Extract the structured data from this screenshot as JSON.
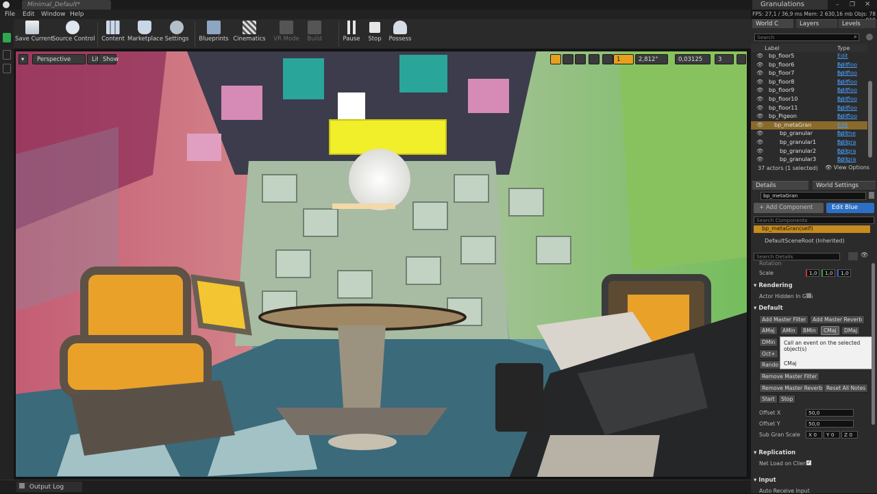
{
  "title_bar": {
    "tab": "Minimal_Default*",
    "project": "Granulations"
  },
  "menu": [
    "File",
    "Edit",
    "Window",
    "Help"
  ],
  "stats": "FPS: 27,1 / 36,9 ms Mem: 2 630,16 mb Objs: 78 919",
  "toolbar": [
    {
      "label": "Save Current",
      "enabled": true
    },
    {
      "label": "Source Control",
      "enabled": true
    },
    {
      "label": "Content",
      "enabled": true
    },
    {
      "label": "Marketplace",
      "enabled": true
    },
    {
      "label": "Settings",
      "enabled": true
    },
    {
      "label": "Blueprints",
      "enabled": true
    },
    {
      "label": "Cinematics",
      "enabled": true
    },
    {
      "label": "VR Mode",
      "enabled": false
    },
    {
      "label": "Build",
      "enabled": false
    },
    {
      "label": "Pause",
      "enabled": true
    },
    {
      "label": "Stop",
      "enabled": true
    },
    {
      "label": "Possess",
      "enabled": true
    }
  ],
  "viewport": {
    "perspective": "Perspective",
    "lit": "Lit",
    "show": "Show",
    "rotation_snap": "2,812°",
    "scale_snap": "0,03125",
    "camera_speed": "3",
    "grid_snap": "1"
  },
  "status_bar": {
    "output_log": "Output Log"
  },
  "outliner": {
    "tabs": [
      "World C",
      "Layers",
      "Levels"
    ],
    "search_placeholder": "Search",
    "col_label": "Label",
    "col_type": "Type",
    "items": [
      {
        "name": "bp_floor5",
        "type": "Edit bp_floo",
        "indent": 1,
        "selected": false
      },
      {
        "name": "bp_floor6",
        "type": "Edit bp_floo",
        "indent": 1,
        "selected": false
      },
      {
        "name": "bp_floor7",
        "type": "Edit bp_floo",
        "indent": 1,
        "selected": false
      },
      {
        "name": "bp_floor8",
        "type": "Edit bp_floo",
        "indent": 1,
        "selected": false
      },
      {
        "name": "bp_floor9",
        "type": "Edit bp_floo",
        "indent": 1,
        "selected": false
      },
      {
        "name": "bp_floor10",
        "type": "Edit bp_floo",
        "indent": 1,
        "selected": false
      },
      {
        "name": "bp_floor11",
        "type": "Edit bp_floo",
        "indent": 1,
        "selected": false
      },
      {
        "name": "bp_Pigeon",
        "type": "Edit bp_Pig",
        "indent": 1,
        "selected": false
      },
      {
        "name": "bp_metaGran",
        "type": "Edit bp_me",
        "indent": 2,
        "selected": true
      },
      {
        "name": "bp_granular",
        "type": "Edit bp_gra",
        "indent": 3,
        "selected": false
      },
      {
        "name": "bp_granular1",
        "type": "Edit bp_gra",
        "indent": 3,
        "selected": false
      },
      {
        "name": "bp_granular2",
        "type": "Edit bp_gra",
        "indent": 3,
        "selected": false
      },
      {
        "name": "bp_granular3",
        "type": "Edit bp_gra",
        "indent": 3,
        "selected": false
      }
    ],
    "footer_count": "37 actors (1 selected)",
    "view_options": "View Options"
  },
  "details": {
    "tabs": [
      "Details",
      "World Settings"
    ],
    "actor_name": "bp_metaGran",
    "add_component": "+ Add Component",
    "edit_blueprint": "Edit Blue",
    "search_components_placeholder": "Search Components",
    "components": [
      "bp_metaGran(self)",
      "DefaultSceneRoot (Inherited)"
    ],
    "search_details_placeholder": "Search Details",
    "rotation_label": "Rotation",
    "scale_label": "Scale",
    "scale_values": [
      "1,0",
      "1,0",
      "1,0"
    ],
    "rendering_section": "Rendering",
    "actor_hidden_label": "Actor Hidden In Gan",
    "default_section": "Default",
    "buttons_row1": [
      "Add Master Filter",
      "Add Master Reverb"
    ],
    "buttons_row2": [
      "AMaj",
      "AMin",
      "BMin",
      "CMaj",
      "DMaj"
    ],
    "buttons_partial": [
      "DMin",
      "Oct+",
      "Rando"
    ],
    "remove_filter": "Remove Master Filter",
    "remove_reverb": "Remove Master Reverb",
    "reset_notes": "Reset All Notes",
    "start": "Start",
    "stop": "Stop",
    "tooltip_text": "Call an event on the selected object(s)",
    "tooltip_sub": "CMaj",
    "offset_x_label": "Offset X",
    "offset_x_value": "50,0",
    "offset_y_label": "Offset Y",
    "offset_y_value": "50,0",
    "sub_gran_label": "Sub Gran Scale",
    "sub_gran_values": [
      "X 0",
      "Y 0",
      "Z 0"
    ],
    "replication_section": "Replication",
    "net_load_label": "Net Load on Client",
    "net_load_checked": true,
    "input_section": "Input",
    "auto_receive_label": "Auto Receive Input"
  }
}
